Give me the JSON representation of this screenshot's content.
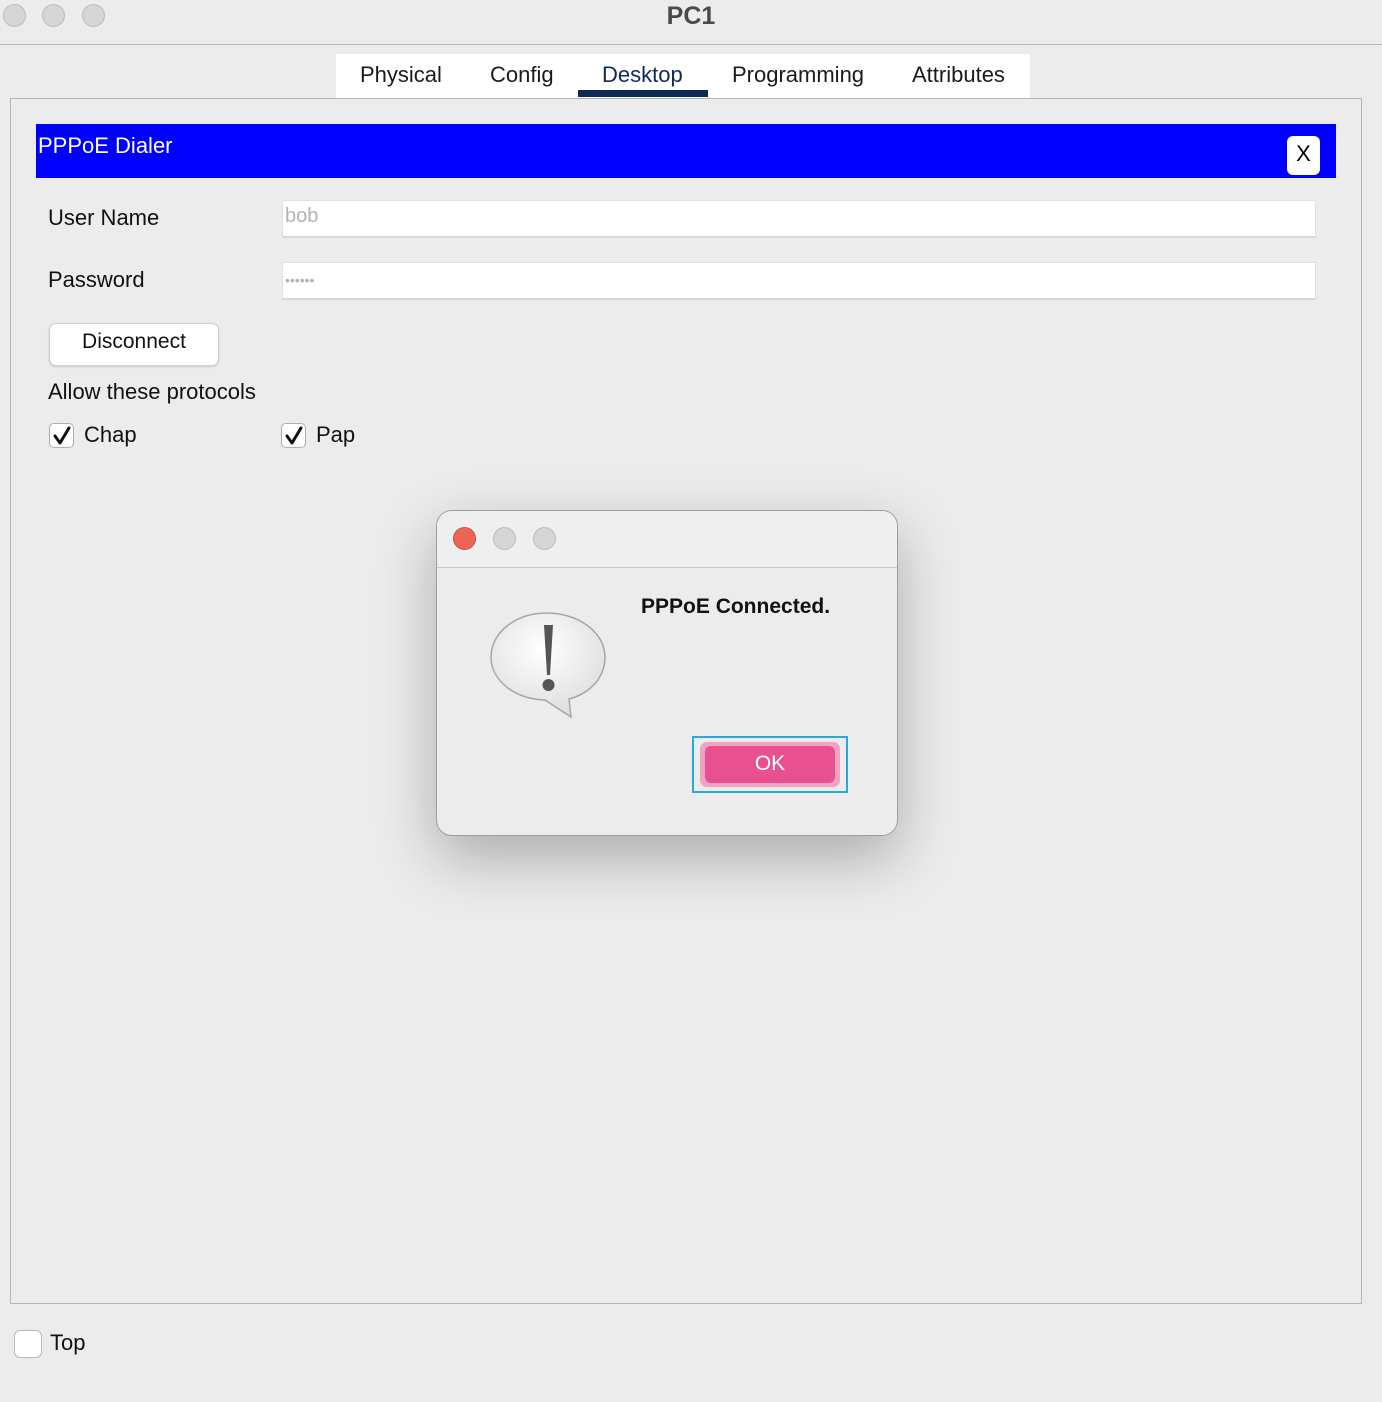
{
  "window": {
    "title": "PC1"
  },
  "tabs": [
    {
      "label": "Physical",
      "active": false
    },
    {
      "label": "Config",
      "active": false
    },
    {
      "label": "Desktop",
      "active": true
    },
    {
      "label": "Programming",
      "active": false
    },
    {
      "label": "Attributes",
      "active": false
    }
  ],
  "dialer": {
    "title": "PPPoE Dialer",
    "close_label": "X",
    "username_label": "User Name",
    "username_value": "bob",
    "password_label": "Password",
    "password_value": "••••••",
    "disconnect_label": "Disconnect",
    "protocols_label": "Allow these protocols",
    "chap_label": "Chap",
    "chap_checked": true,
    "pap_label": "Pap",
    "pap_checked": true
  },
  "alert": {
    "message": "PPPoE Connected.",
    "ok_label": "OK",
    "icon": "exclamation-bubble-icon"
  },
  "footer": {
    "top_label": "Top",
    "top_checked": false
  },
  "colors": {
    "header_blue": "#0000ff",
    "tab_accent": "#0f2a55",
    "ok_button": "#e8508f",
    "close_red": "#ec6559",
    "focus_ring": "#2aa8d8"
  }
}
